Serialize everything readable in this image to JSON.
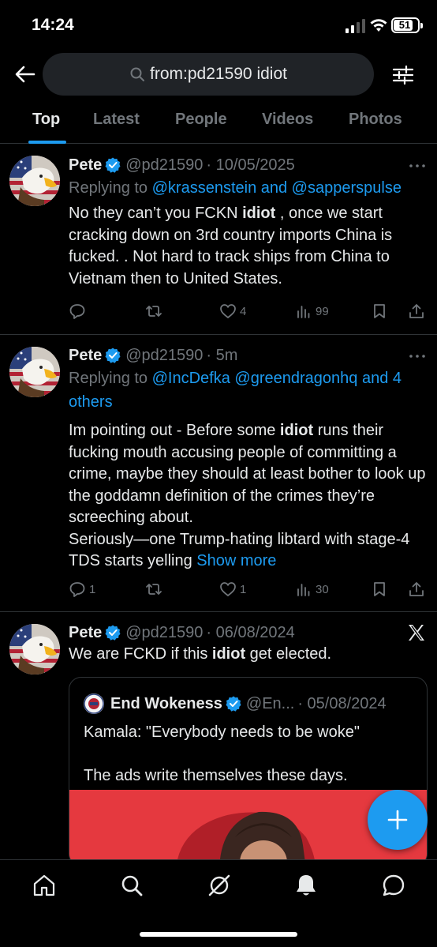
{
  "status_bar": {
    "time": "14:24",
    "battery_level": "51"
  },
  "search": {
    "query": "from:pd21590 idiot"
  },
  "tabs": [
    {
      "label": "Top",
      "active": true
    },
    {
      "label": "Latest"
    },
    {
      "label": "People"
    },
    {
      "label": "Videos"
    },
    {
      "label": "Photos"
    }
  ],
  "tweets": [
    {
      "name": "Pete",
      "handle": "@pd21590",
      "time": "· 10/05/2025",
      "replying_prefix": "Replying to ",
      "replying_to": "@krassenstein and @sapperspulse",
      "body_parts": [
        "No they can’t you FCKN ",
        "idiot",
        " , once we start cracking down on 3rd country imports China is fucked. .  Not hard to track ships from China to Vietnam then to United States."
      ],
      "stats": {
        "replies": "",
        "reposts": "",
        "likes": "4",
        "views": "99"
      }
    },
    {
      "name": "Pete",
      "handle": "@pd21590",
      "time": "· 5m",
      "replying_prefix": "Replying to ",
      "replying_to": "@IncDefka @greendragonhq and 4 others",
      "body_parts": [
        "Im pointing out - Before some ",
        "idiot",
        " runs their fucking mouth accusing people of committing a crime, maybe they should at least bother to look up the goddamn definition of the crimes they’re screeching about.\nSeriously—one Trump-hating libtard with stage-4 TDS starts yelling "
      ],
      "show_more": "Show more",
      "stats": {
        "replies": "1",
        "reposts": "",
        "likes": "1",
        "views": "30"
      }
    },
    {
      "name": "Pete",
      "handle": "@pd21590",
      "time": "· 06/08/2024",
      "body_parts": [
        "We are FCKD if this ",
        "idiot",
        " get elected."
      ],
      "quote": {
        "name": "End Wokeness",
        "handle": "@En...",
        "time": "· 05/08/2024",
        "text": "Kamala: \"Everybody needs to be woke\"\n\nThe ads write themselves these days."
      }
    }
  ],
  "colors": {
    "accent": "#1d9bf0",
    "muted": "#71767b",
    "text": "#e7e9ea",
    "border": "#2f3336"
  }
}
